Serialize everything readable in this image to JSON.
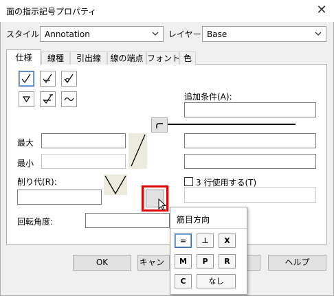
{
  "window": {
    "title": "面の指示記号プロパティ",
    "close_glyph": "✕"
  },
  "style_row": {
    "style_label": "スタイル:",
    "style_value": "Annotation",
    "layer_label": "レイヤー:",
    "layer_value": "Base"
  },
  "tabs": [
    {
      "label": "仕様"
    },
    {
      "label": "線種"
    },
    {
      "label": "引出線"
    },
    {
      "label": "線の端点"
    },
    {
      "label": "フォント"
    },
    {
      "label": "色"
    }
  ],
  "spec": {
    "max_label": "最大",
    "min_label": "最小",
    "allowance_label": "削り代(R):",
    "rotation_label": "回転角度:",
    "condition_label": "追加条件(A):",
    "three_rows_label": "3 行使用する(T)",
    "symbol_buttons": [
      "basic-symbol",
      "removal-required",
      "removal-prohibited",
      "basic-triangle",
      "removal-required-all-around",
      "tilde"
    ]
  },
  "popup": {
    "title": "筋目方向",
    "buttons": [
      "=",
      "⊥",
      "X",
      "M",
      "P",
      "R",
      "C",
      "なし"
    ]
  },
  "footer": {
    "ok_label": "OK",
    "cancel_label": "キャン",
    "help_label": "ヘルプ"
  },
  "colors": {
    "highlight": "#e00000",
    "selection": "#3b6fb6"
  }
}
